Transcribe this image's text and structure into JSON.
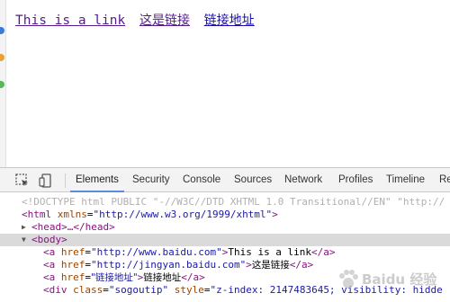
{
  "rendered_page": {
    "links": [
      "This is a link",
      "这是链接",
      "链接地址"
    ]
  },
  "devtools": {
    "tools": {
      "inspect_icon": "inspect-element-icon",
      "device_icon": "device-mode-icon"
    },
    "tabs": [
      "Elements",
      "Security",
      "Console",
      "Sources",
      "Network",
      "Profiles",
      "Timeline",
      "Re"
    ],
    "active_tab": "Elements",
    "dom": {
      "doctype": "<!DOCTYPE html PUBLIC \"-//W3C//DTD XHTML 1.0 Transitional//EN\" \"http://",
      "html_tag_open": "<html",
      "html_attr": "xmlns",
      "html_attr_val": "\"http://www.w3.org/1999/xhtml\"",
      "html_tag_close": ">",
      "head_collapsed": "<head>…</head>",
      "body_tag": "<body>",
      "link1": {
        "open": "<a",
        "attr": "href",
        "val": "\"http://www.baidu.com\"",
        "gt": ">",
        "text": "This is a link",
        "close": "</a>"
      },
      "link2": {
        "open": "<a",
        "attr": "href",
        "val": "\"http://jingyan.baidu.com\"",
        "gt": ">",
        "text": "这是链接",
        "close": "</a>"
      },
      "link3": {
        "open": "<a",
        "attr": "href",
        "val": "\"链接地址\"",
        "gt": ">",
        "text": "链接地址",
        "close": "</a>"
      },
      "div": {
        "open": "<div",
        "attr1": "class",
        "val1": "\"sogoutip\"",
        "attr2": "style",
        "val2": "\"z-index: 2147483645; visibility: hidde"
      }
    }
  },
  "watermark": "Baidu 经验",
  "colors": {
    "link_visited": "#551a8b",
    "link_unvisited": "#1a0dab",
    "tab_active_underline": "#5a8cd9",
    "selected_row": "#dadada"
  }
}
